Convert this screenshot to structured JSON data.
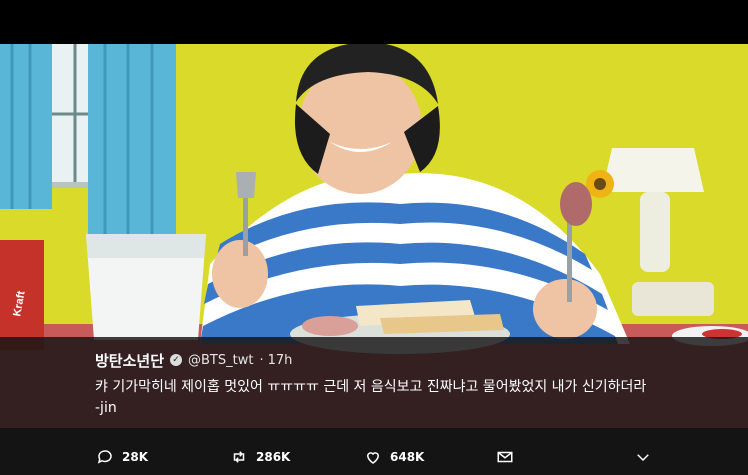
{
  "tweet": {
    "name": "방탄소년단",
    "handle": "@BTS_twt",
    "separator": "·",
    "time": "17h",
    "text": "캬 기가막히네 제이홉 멋있어 ㅠㅠㅠㅠ 근데 저 음식보고 진짜냐고 물어봤었지 내가 신기하더라 -jin"
  },
  "actions": {
    "reply_count": "28K",
    "retweet_count": "286K",
    "like_count": "648K"
  },
  "video_labels": {
    "carton_brand": "Kraft"
  },
  "icons": {
    "verified": "verified-badge-icon",
    "reply": "reply-icon",
    "retweet": "retweet-icon",
    "like": "heart-icon",
    "dm": "envelope-icon",
    "more": "chevron-down-icon"
  },
  "colors": {
    "wall": "#d9d92a",
    "stripe_blue": "#3a78c8",
    "curtain": "#59b7d8",
    "overlay": "#141414"
  }
}
